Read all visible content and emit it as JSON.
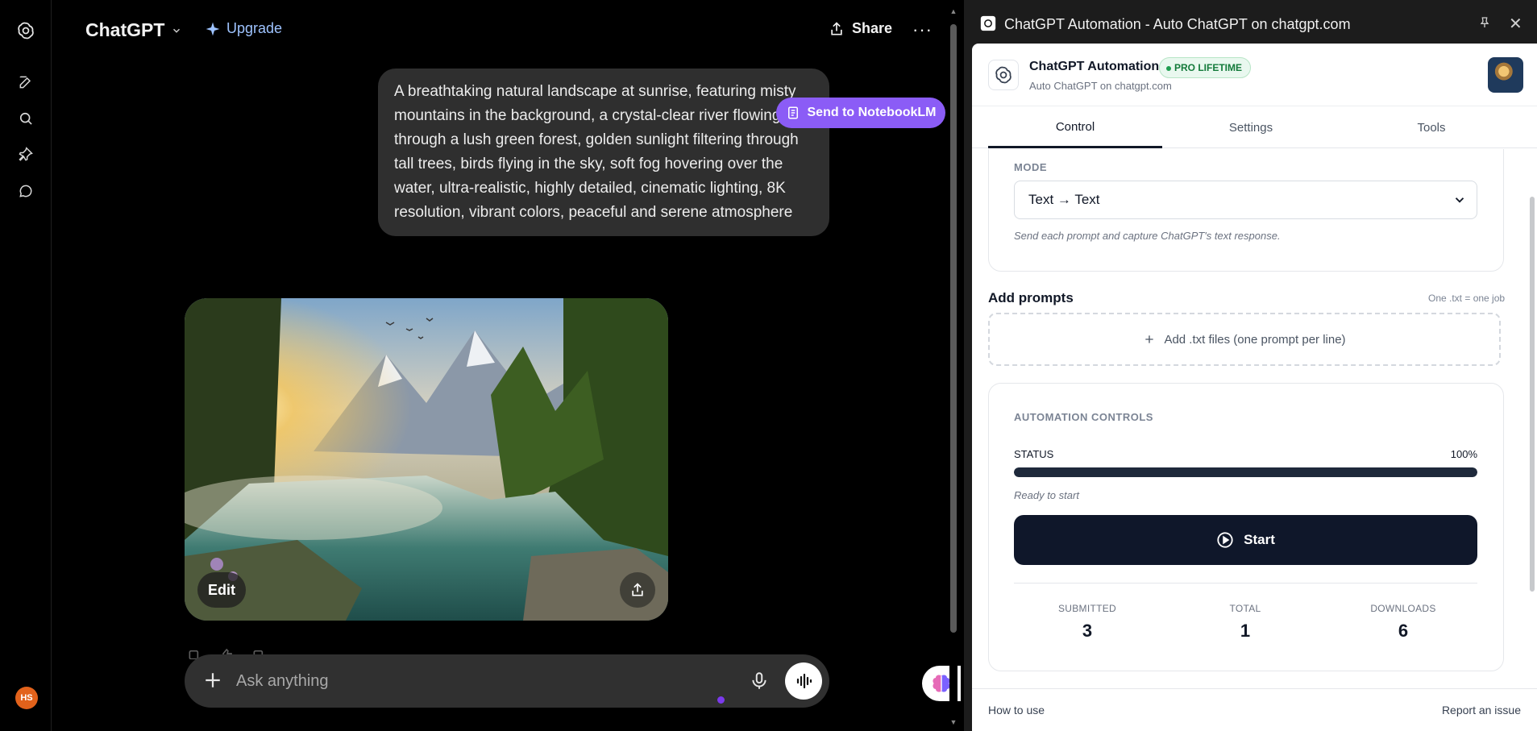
{
  "app": {
    "brand": "ChatGPT",
    "upgrade_label": "Upgrade",
    "share_label": "Share",
    "more_label": "···",
    "avatar_initials": "HS",
    "user_prompt": "A breathtaking natural landscape at sunrise, featuring misty mountains in the background, a crystal-clear river flowing through a lush green forest, golden sunlight filtering through tall trees, birds flying in the sky, soft fog hovering over the water, ultra-realistic, highly detailed, cinematic lighting, 8K resolution, vibrant colors, peaceful and serene atmosphere",
    "notebook_button": "Send to NotebookLM",
    "image_edit_label": "Edit",
    "composer_placeholder": "Ask anything",
    "colors": {
      "notebook_purple": "#8b5cf6",
      "upgrade_blue": "#9ec3ff",
      "avatar_orange": "#e2621b"
    }
  },
  "panel": {
    "window_title": "ChatGPT Automation - Auto ChatGPT on chatgpt.com",
    "ext_name": "ChatGPT Automation",
    "badge": "PRO LIFETIME",
    "ext_subtitle": "Auto ChatGPT on chatgpt.com",
    "tabs": [
      {
        "label": "Control",
        "active": true
      },
      {
        "label": "Settings",
        "active": false
      },
      {
        "label": "Tools",
        "active": false
      }
    ],
    "mode": {
      "label": "MODE",
      "selected": "Text → Text",
      "hint": "Send each prompt and capture ChatGPT's text response."
    },
    "add_prompts": {
      "title": "Add prompts",
      "note": "One .txt = one job",
      "dropzone_label": "Add .txt files (one prompt per line)"
    },
    "controls": {
      "title": "AUTOMATION CONTROLS",
      "status_label": "STATUS",
      "progress_text": "100%",
      "progress_fraction": 1.0,
      "ready_text": "Ready to start",
      "start_label": "Start",
      "stats": [
        {
          "label": "SUBMITTED",
          "value": "3"
        },
        {
          "label": "TOTAL",
          "value": "1"
        },
        {
          "label": "DOWNLOADS",
          "value": "6"
        }
      ]
    },
    "footer": {
      "left": "How to use",
      "right": "Report an issue"
    },
    "colors": {
      "badge_green": "#137a3a",
      "start_navy": "#0f172a",
      "progress_fill": "#1e293b"
    }
  }
}
